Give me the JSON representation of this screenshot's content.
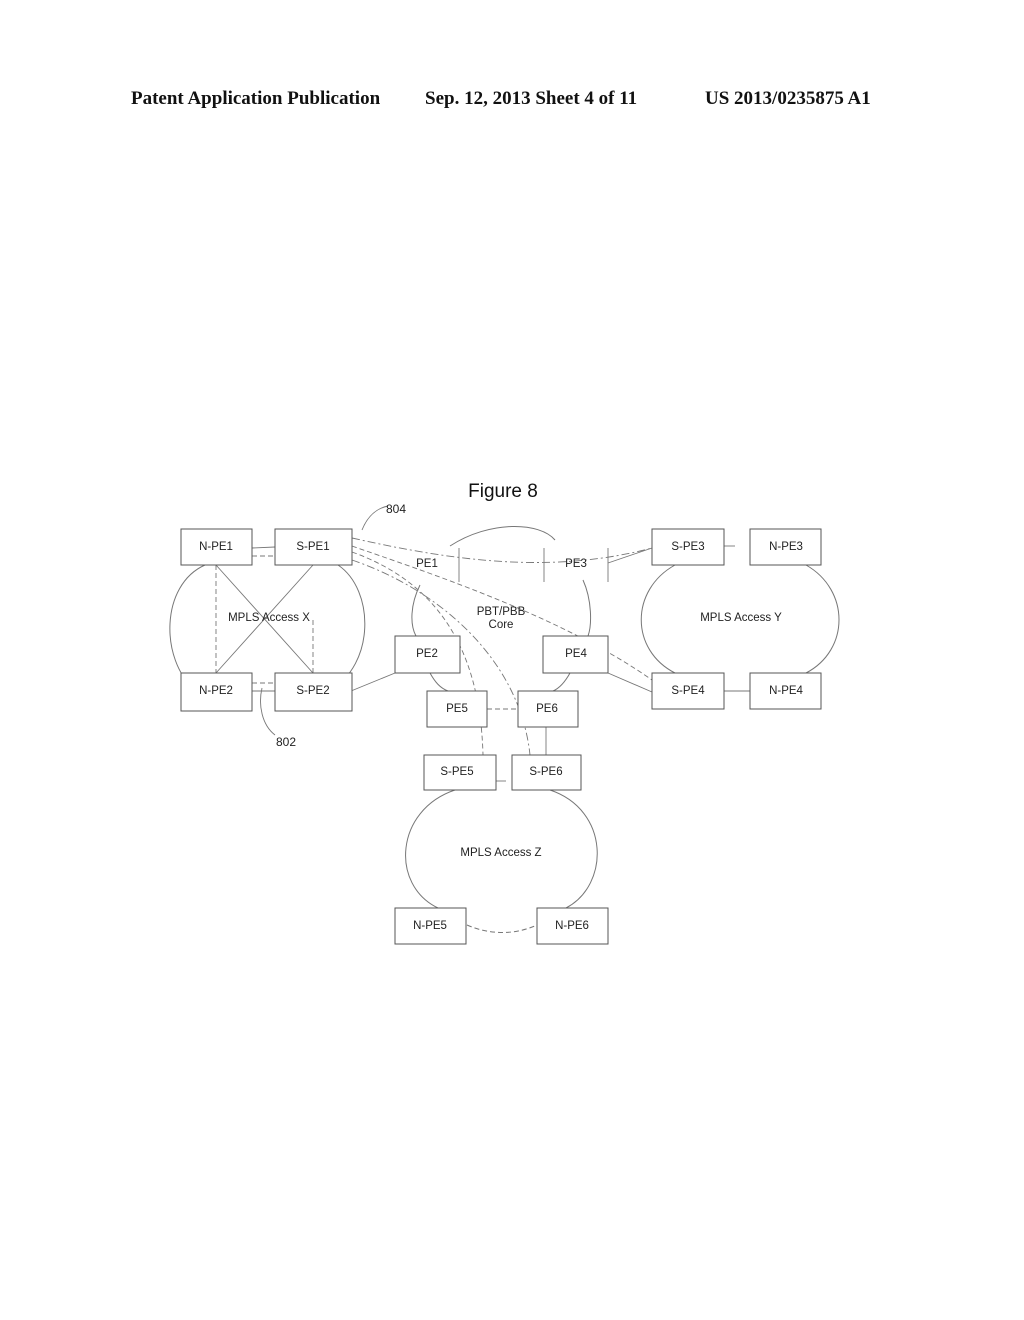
{
  "header": {
    "publication": "Patent Application Publication",
    "date_sheet": "Sep. 12, 2013   Sheet 4 of 11",
    "number": "US 2013/0235875 A1"
  },
  "figure": {
    "title": "Figure 8",
    "refs": {
      "r804": "804",
      "r802": "802"
    },
    "clouds": {
      "access_x": "MPLS Access X",
      "access_y": "MPLS Access Y",
      "access_z": "MPLS Access Z",
      "core_line1": "PBT/PBB",
      "core_line2": "Core"
    },
    "nodes": {
      "npe1": "N-PE1",
      "spe1": "S-PE1",
      "npe2": "N-PE2",
      "spe2": "S-PE2",
      "spe3": "S-PE3",
      "npe3": "N-PE3",
      "spe4": "S-PE4",
      "npe4": "N-PE4",
      "pe1": "PE1",
      "pe2": "PE2",
      "pe3": "PE3",
      "pe4": "PE4",
      "pe5": "PE5",
      "pe6": "PE6",
      "spe5": "S-PE5",
      "spe6": "S-PE6",
      "npe5": "N-PE5",
      "npe6": "N-PE6"
    }
  }
}
